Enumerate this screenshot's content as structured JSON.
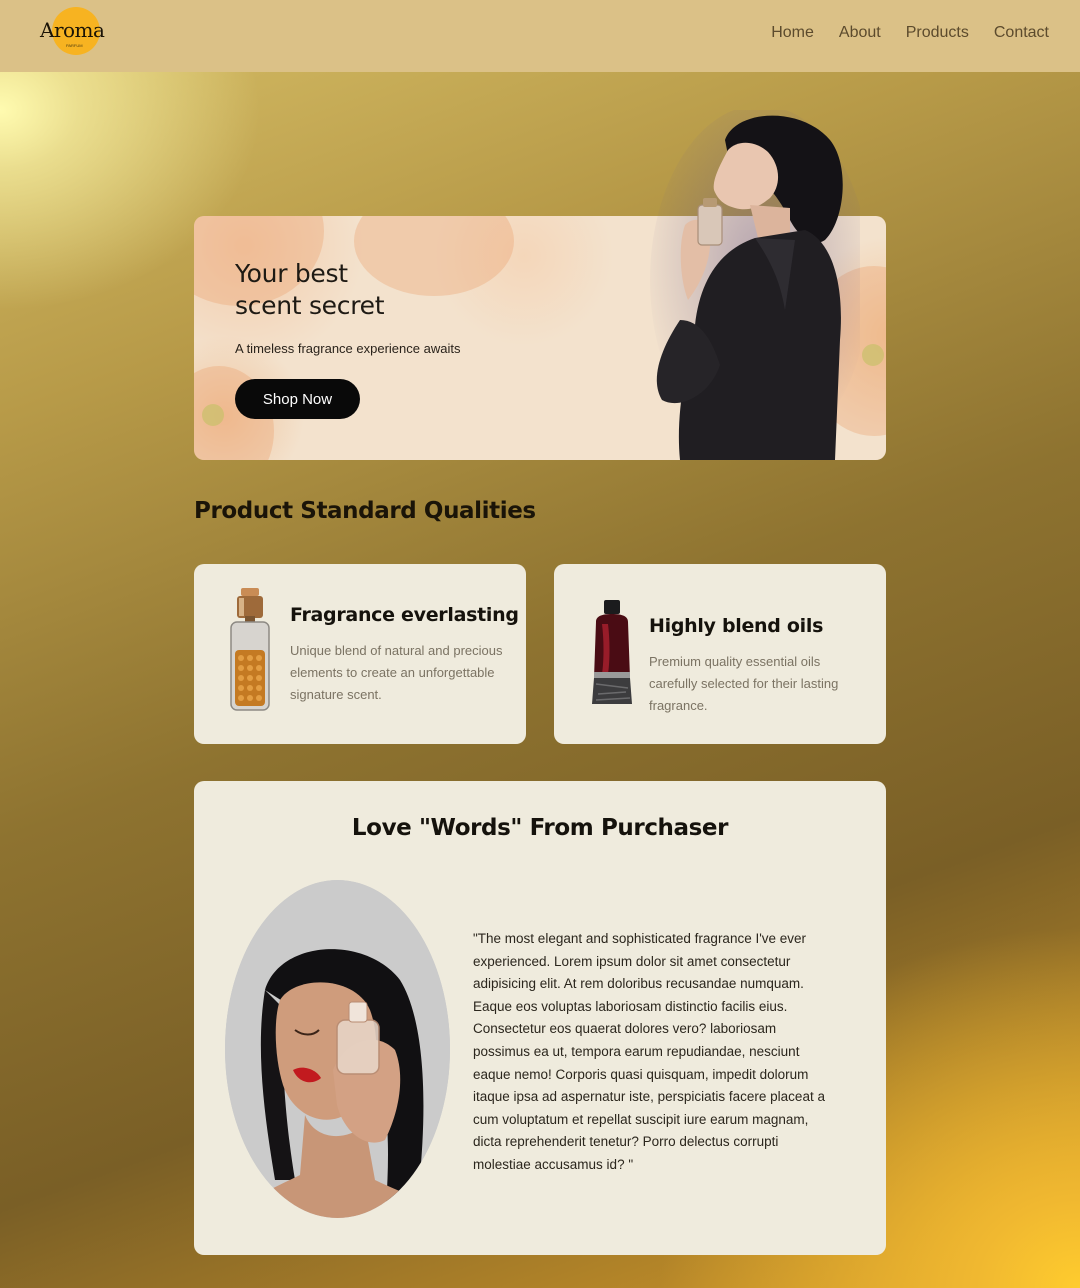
{
  "header": {
    "logo_text": "Aroma",
    "logo_tagline": "PARFUM",
    "nav": [
      "Home",
      "About",
      "Products",
      "Contact"
    ]
  },
  "hero": {
    "title_line1": "Your best",
    "title_line2": "scent secret",
    "subtitle": "A timeless fragrance experience awaits",
    "cta_label": "Shop Now"
  },
  "qualities": {
    "section_title": "Product Standard Qualities",
    "cards": [
      {
        "title": "Fragrance everlasting",
        "description": "Unique blend of natural and precious elements to create an unforgettable signature scent.",
        "icon": "amber-perfume-bottle"
      },
      {
        "title": "Highly blend oils",
        "description": "Premium quality essential oils carefully selected for their lasting fragrance.",
        "icon": "dark-red-perfume-bottle"
      }
    ]
  },
  "testimonial": {
    "title": "Love \"Words\" From Purchaser",
    "quote": "\"The most elegant and sophisticated fragrance I've ever experienced. Lorem ipsum dolor sit amet consectetur adipisicing elit. At rem doloribus recusandae numquam. Eaque eos voluptas laboriosam distinctio facilis eius. Consectetur eos quaerat dolores vero? laboriosam possimus ea ut, tempora earum repudiandae, nesciunt eaque nemo! Corporis quasi quisquam, impedit dolorum itaque ipsa ad aspernatur iste, perspiciatis facere placeat a cum voluptatum et repellat suscipit iure earum magnam, dicta reprehenderit tenetur? Porro delectus corrupti molestiae accusamus id? \""
  },
  "colors": {
    "header_bg": "#dbc187",
    "card_bg": "#efebdd",
    "button_bg": "#090909",
    "logo_accent": "#f7b321"
  }
}
